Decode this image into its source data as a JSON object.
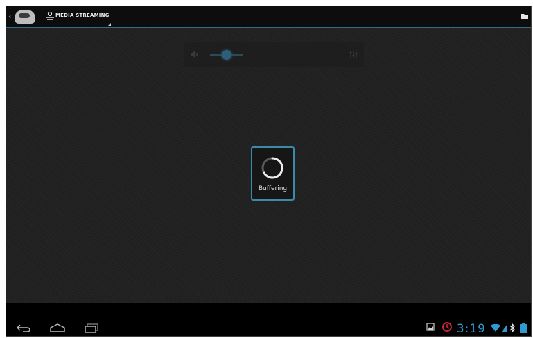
{
  "action_bar": {
    "title": "MEDIA STREAMING",
    "app_icon": "headphones-logo-icon",
    "title_icon": "media-streaming-icon",
    "overflow_icon": "folder-icon",
    "accent_color": "#2f6f86"
  },
  "volume": {
    "mute_icon": "speaker-icon",
    "settings_icon": "equalizer-icon",
    "level": 0.5
  },
  "buffering": {
    "label": "Buffering",
    "border_color": "#3a8aa8"
  },
  "nav_bar": {
    "back_icon": "back-icon",
    "home_icon": "home-icon",
    "recents_icon": "recent-apps-icon"
  },
  "status": {
    "clock": "3:19",
    "notification_icons": [
      "gallery-icon",
      "alarm-icon"
    ],
    "system_icons": [
      "wifi-icon",
      "signal-icon",
      "bluetooth-icon",
      "battery-icon"
    ],
    "clock_color": "#2f9ad0"
  }
}
